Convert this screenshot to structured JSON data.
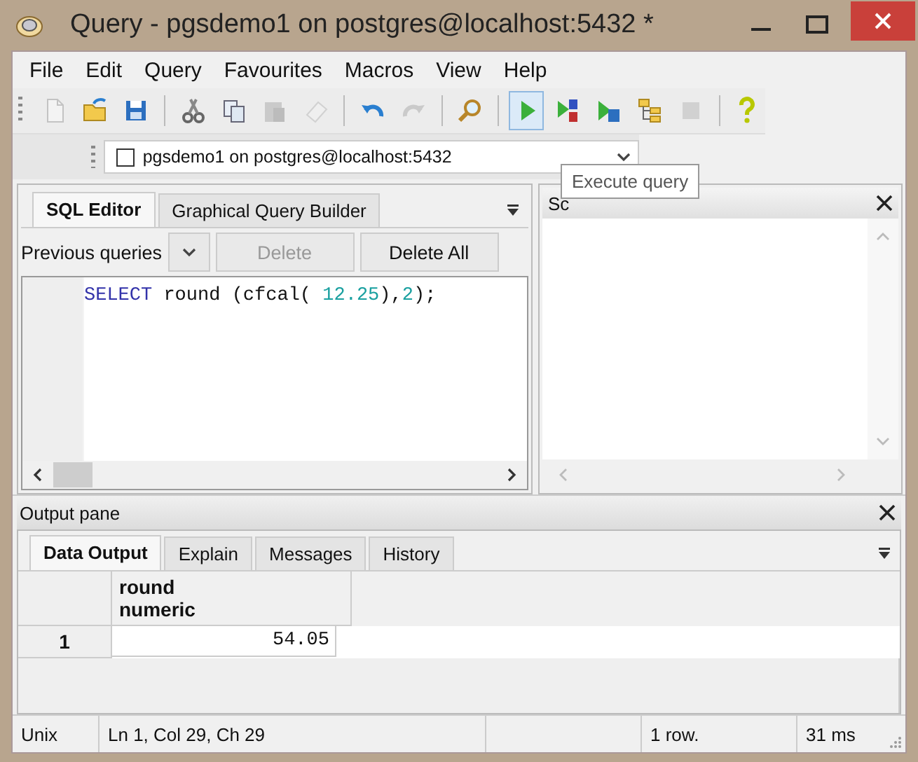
{
  "window": {
    "title": "Query - pgsdemo1 on postgres@localhost:5432 *"
  },
  "menu": [
    "File",
    "Edit",
    "Query",
    "Favourites",
    "Macros",
    "View",
    "Help"
  ],
  "toolbar": [
    [
      {
        "kind": "new",
        "disabled": true,
        "selected": false
      },
      {
        "kind": "open",
        "disabled": false,
        "selected": false
      },
      {
        "kind": "save",
        "disabled": false,
        "selected": false
      }
    ],
    [
      {
        "kind": "cut",
        "disabled": false,
        "selected": false
      },
      {
        "kind": "copy",
        "disabled": false,
        "selected": false
      },
      {
        "kind": "paste",
        "disabled": true,
        "selected": false
      },
      {
        "kind": "clear",
        "disabled": true,
        "selected": false
      }
    ],
    [
      {
        "kind": "undo",
        "disabled": false,
        "selected": false
      },
      {
        "kind": "redo",
        "disabled": true,
        "selected": false
      }
    ],
    [
      {
        "kind": "find",
        "disabled": false,
        "selected": false
      }
    ],
    [
      {
        "kind": "execute",
        "disabled": false,
        "selected": true
      },
      {
        "kind": "pgscript",
        "disabled": false,
        "selected": false
      },
      {
        "kind": "execute-file",
        "disabled": false,
        "selected": false
      },
      {
        "kind": "explain",
        "disabled": false,
        "selected": false
      },
      {
        "kind": "cancel",
        "disabled": true,
        "selected": false
      }
    ],
    [
      {
        "kind": "help",
        "disabled": false,
        "selected": false
      }
    ]
  ],
  "connection": {
    "checked": false,
    "label": "pgsdemo1 on postgres@localhost:5432"
  },
  "tooltip": {
    "text": "Execute query"
  },
  "sql_editor": {
    "tabs": [
      {
        "label": "SQL Editor",
        "selected": true
      },
      {
        "label": "Graphical Query Builder",
        "selected": false
      }
    ],
    "previous_queries_label": "Previous queries",
    "buttons": [
      {
        "label": "Delete",
        "disabled": true
      },
      {
        "label": "Delete All",
        "disabled": false
      }
    ],
    "code": [
      {
        "kind": "keyword",
        "text": "SELECT"
      },
      {
        "kind": "plain",
        "text": " round (cfcal( "
      },
      {
        "kind": "number",
        "text": "12.25"
      },
      {
        "kind": "plain",
        "text": "),"
      },
      {
        "kind": "number",
        "text": "2"
      },
      {
        "kind": "plain",
        "text": ");"
      }
    ]
  },
  "scratch_pad": {
    "title": "Sc"
  },
  "output_pane": {
    "title": "Output pane",
    "tabs": [
      {
        "label": "Data Output",
        "selected": true
      },
      {
        "label": "Explain",
        "selected": false
      },
      {
        "label": "Messages",
        "selected": false
      },
      {
        "label": "History",
        "selected": false
      }
    ],
    "columns": [
      {
        "name": "round",
        "type": "numeric"
      }
    ],
    "rows": [
      {
        "number": "1",
        "cells": [
          "54.05"
        ]
      }
    ]
  },
  "status_bar": [
    "Unix",
    "Ln 1, Col 29, Ch 29",
    "1 row.",
    "31 ms"
  ]
}
